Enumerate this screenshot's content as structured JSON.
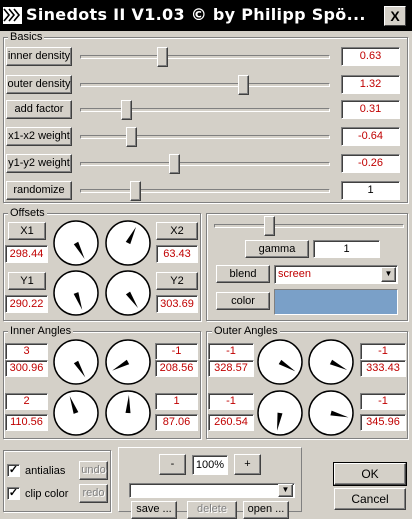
{
  "window": {
    "title": "Sinedots II V1.03 © by Philipp Spö...",
    "close": "X"
  },
  "basics": {
    "title": "Basics",
    "rows": [
      {
        "label": "inner density",
        "value": "0.63",
        "level": 0.32
      },
      {
        "label": "outer density",
        "value": "1.32",
        "level": 0.66
      },
      {
        "label": "add factor",
        "value": "0.31",
        "level": 0.17
      },
      {
        "label": "x1-x2 weight",
        "value": "-0.64",
        "level": 0.19
      },
      {
        "label": "y1-y2 weight",
        "value": "-0.26",
        "level": 0.37
      },
      {
        "label": "randomize",
        "value": "1",
        "level": 0.21
      }
    ]
  },
  "offsets": {
    "title": "Offsets",
    "x1": {
      "label": "X1",
      "value": "298.44"
    },
    "x2": {
      "label": "X2",
      "value": "63.43"
    },
    "y1": {
      "label": "Y1",
      "value": "290.22"
    },
    "y2": {
      "label": "Y2",
      "value": "303.69"
    }
  },
  "gamma": {
    "label": "gamma",
    "value": "1",
    "level": 0.28
  },
  "blend": {
    "label": "blend",
    "value": "screen"
  },
  "color": {
    "label": "color",
    "swatch": "#7aa0c8"
  },
  "inner_angles": {
    "title": "Inner Angles",
    "values": [
      "3",
      "-1",
      "300.96",
      "208.56",
      "2",
      "1",
      "110.56",
      "87.06"
    ]
  },
  "outer_angles": {
    "title": "Outer Angles",
    "values": [
      "-1",
      "-1",
      "328.57",
      "333.43",
      "-1",
      "-1",
      "260.54",
      "345.96"
    ]
  },
  "options": {
    "antialias": "antialias",
    "clip_color": "clip color",
    "undo": "undo",
    "redo": "redo"
  },
  "zoom": {
    "minus": "-",
    "value": "100%",
    "plus": "+"
  },
  "file": {
    "save": "save ...",
    "delete": "delete",
    "open": "open ..."
  },
  "dialog": {
    "ok": "OK",
    "cancel": "Cancel"
  }
}
